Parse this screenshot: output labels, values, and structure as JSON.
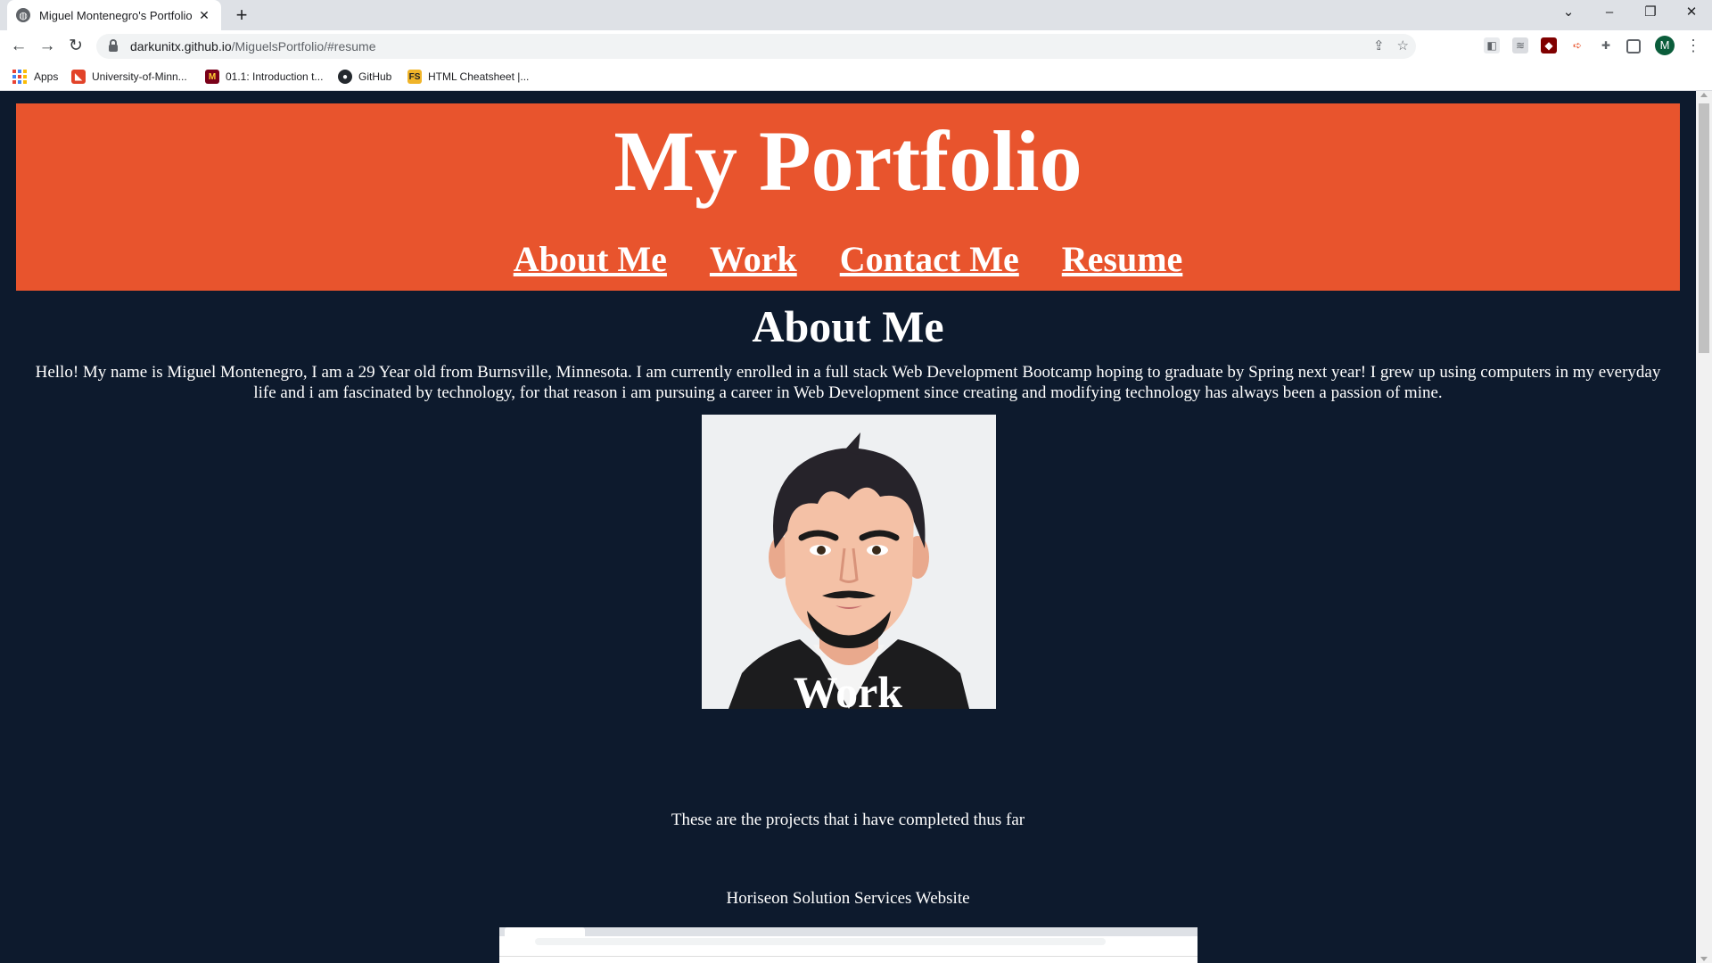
{
  "browser": {
    "tab_title": "Miguel Montenegro's Portfolio",
    "tab_close": "✕",
    "new_tab": "+",
    "url_host": "darkunitx.github.io",
    "url_path": "/MiguelsPortfolio/#resume",
    "profile_initial": "M",
    "bookmarks": [
      {
        "label": "Apps",
        "icon": "apps-grid-icon"
      },
      {
        "label": "University-of-Minn...",
        "icon": "gitlab-icon",
        "color": "#e24329"
      },
      {
        "label": "01.1: Introduction t...",
        "icon": "umn-icon",
        "color": "#7a0019"
      },
      {
        "label": "GitHub",
        "icon": "github-icon",
        "color": "#24292e"
      },
      {
        "label": "HTML Cheatsheet |...",
        "icon": "fs-icon",
        "color": "#f0b429"
      }
    ]
  },
  "page": {
    "header_title": "My Portfolio",
    "nav": [
      "About Me",
      "Work",
      "Contact Me",
      "Resume"
    ],
    "about": {
      "heading": "About Me",
      "text": "Hello! My name is Miguel Montenegro, I am a 29 Year old from Burnsville, Minnesota. I am currently enrolled in a full stack Web Development Bootcamp hoping to graduate by Spring next year! I grew up using computers in my everyday life and i am fascinated by technology, for that reason i am pursuing a career in Web Development since creating and modifying technology has always been a passion of mine."
    },
    "work": {
      "heading": "Work",
      "text": "These are the projects that i have completed thus far",
      "projects": [
        {
          "title": "Horiseon Solution Services Website"
        }
      ]
    }
  },
  "colors": {
    "header_bg": "#e8542d",
    "page_bg": "#0d1a2d",
    "text": "#ffffff"
  }
}
